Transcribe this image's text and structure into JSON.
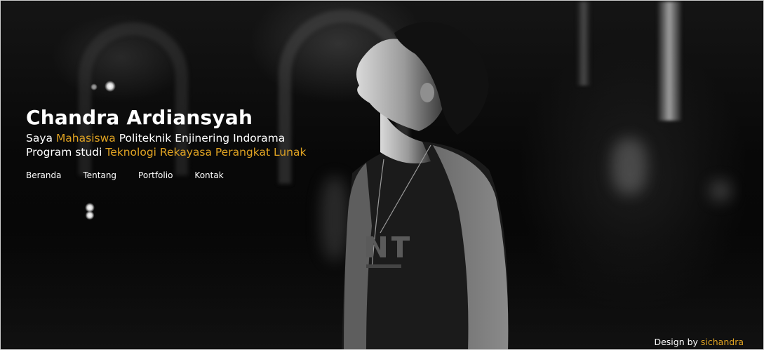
{
  "hero": {
    "name": "Chandra Ardiansyah",
    "line1": {
      "prefix": "Saya ",
      "highlight": "Mahasiswa",
      "suffix": " Politeknik Enjinering Indorama"
    },
    "line2": {
      "prefix": "Program studi ",
      "highlight": "Teknologi Rekayasa Perangkat Lunak"
    }
  },
  "nav": {
    "items": [
      "Beranda",
      "Tentang",
      "Portfolio",
      "Kontak"
    ]
  },
  "footer": {
    "prefix": "Design by ",
    "author": "sichandra"
  },
  "colors": {
    "accent": "#e0a322",
    "text": "#ffffff",
    "background": "#0a0a0a"
  },
  "background_image": "black-and-white night photo of a young man looking up"
}
